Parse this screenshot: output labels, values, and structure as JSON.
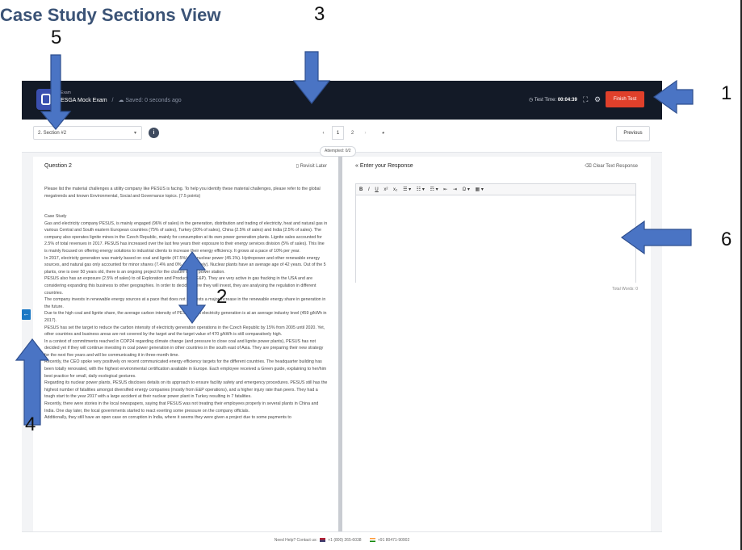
{
  "annotation": {
    "title": "Case Study Sections View",
    "markers": [
      "1",
      "2",
      "3",
      "4",
      "5",
      "6"
    ]
  },
  "header": {
    "exam_small": "Exam",
    "exam_name": "ESGA Mock Exam",
    "saved": "Saved: 0 seconds ago",
    "timer_label": "Test Time:",
    "timer_value": "00:04:39",
    "finish_label": "Finish Test"
  },
  "sectionbar": {
    "section_value": "2. Section #2",
    "pages": [
      "1",
      "2"
    ],
    "active_page": "2",
    "previous_label": "Previous",
    "attempted": "Attempted: 0/2"
  },
  "question": {
    "title": "Question 2",
    "revisit_label": "Revisit Later",
    "prompt": "Please list the material challenges a utility company like PESUS is facing. To help you identify these material challenges, please refer to the global megatrends and known Environmental, Social and Governance topics. (7.5 points)",
    "case_heading": "Case Study",
    "paragraphs": [
      "Gas and electricity company PESUS, is mainly engaged (96% of sales) in the generation, distribution and trading of electricity, heat and natural gas in various Central and South eastern European countries (75% of sales), Turkey (20% of sales), China (2.5% of sales) and India (2.5% of sales). The company also operates lignite mines in the Czech Republic, mainly for consumption at its own power generation plants. Lignite sales accounted for 2.5% of total revenues in 2017. PESUS has increased over the last few years their exposure to their energy services division (5% of sales). This line is mainly focused on offering energy solutions to industrial clients to increase their energy efficiency. It grows at a pace of 10% per year.",
      "In 2017, electricity generation was mainly based on coal and lignite (47.5%) and nuclear power (45.1%). Hydropower and other renewable energy sources, and natural gas only accounted for minor shares (7.4% and 0%, respectively). Nuclear plants have an average age of 42 years. Out of the 5 plants, one is over 50 years old, there is an ongoing project for the closure of this power station.",
      "PESUS also has an exposure (2.5% of sales) to oil Exploration and Production (E&P). They are very active in gas fracking in the USA and are considering expanding this business to other geographies. In order to decide where they will invest, they are analysing the regulation in different countries.",
      "The company invests in renewable energy sources at a pace that does not suggests a major increase in the renewable energy share in generation in the future.",
      "Due to the high coal and lignite share, the average carbon intensity of PESUS total electricity generation is at an average industry level (459 g/kWh in 2017).",
      "PESUS has set the target to reduce the carbon intensity of electricity generation operations in the Czech Republic by 15% from 2005 until 2020. Yet, other countries and business areas are not covered by the target and the target value of 470 g/kWh is still comparatively high.",
      "In a context of commitments reached in COP24 regarding climate change (and pressure to close coal and lignite power plants), PESUS has not decided yet if they will continue investing in coal power generation in other countries in the south east of Asia. They are preparing their new strategy for the next five years and will be communicating it in three-month time.",
      "Recently, the CEO spoke very positively on recent communicated energy efficiency targets for the different countries. The headquarter building has been totally renovated, with the highest environmental certification available in Europe. Each employee received a Green guide, explaining to her/him best practice for small, daily ecological gestures.",
      "Regarding its nuclear power plants, PESUS discloses details on its approach to ensure facility safety and emergency procedures. PESUS still has the highest number of fatalities amongst diversified energy companies (mostly from E&P operations), and a higher injury rate than peers. They had a tough start to the year 2017 with a large accident at their nuclear power plant in Turkey resulting in 7 fatalities.",
      "Recently, there were stories in the local newspapers, saying that PESUS was not treating their employees properly in several plants in China and India. One day later, the local governments started to react exerting some pressure on the company officials.",
      "Additionally, they still have an open case on corruption in India, where it seems they were given a project due to some payments to"
    ]
  },
  "response": {
    "title": "Enter your Response",
    "clear_label": "Clear Text Response",
    "toolbar": [
      "B",
      "I",
      "U",
      "x²",
      "x₂",
      "☰ ▾",
      "☷ ▾",
      "☶ ▾",
      "⇤",
      "⇥",
      "Ω ▾",
      "▦ ▾"
    ],
    "text": "",
    "word_count": "Total Words: 0"
  },
  "footer": {
    "help_label": "Need Help? Contact us:",
    "phone_us": "+1 (800) 265-6038",
    "phone_in": "+91 80471-90902"
  },
  "colors": {
    "topbar": "#131a27",
    "finish_button": "#e0402b",
    "annotation_arrow": "#4a74c4",
    "collapse_button": "#1b78c4"
  }
}
